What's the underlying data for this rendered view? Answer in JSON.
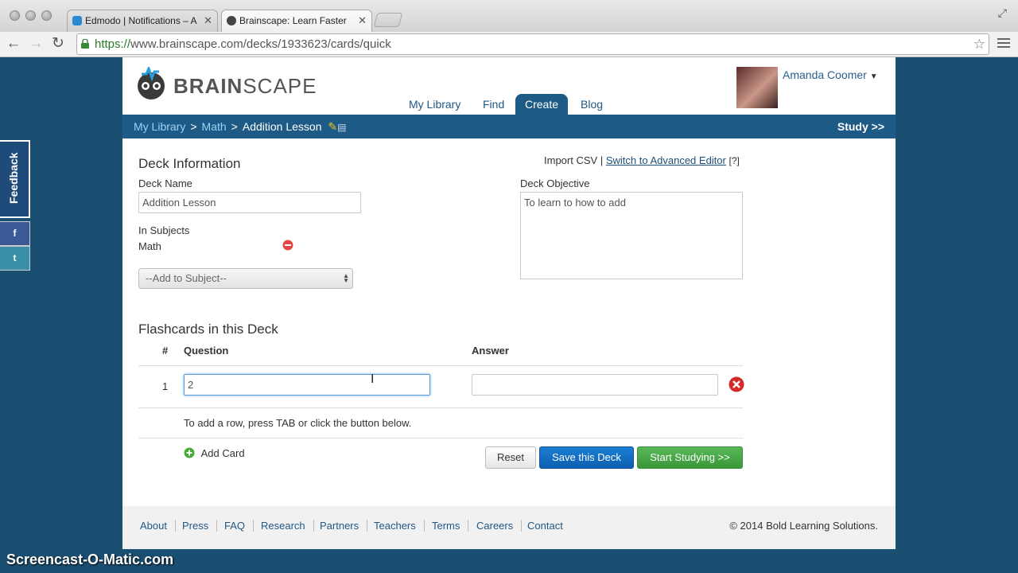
{
  "browser": {
    "tabs": [
      {
        "title": "Edmodo | Notifications – A",
        "active": false
      },
      {
        "title": "Brainscape: Learn Faster",
        "active": true
      }
    ],
    "url_scheme": "https://",
    "url_rest": "www.brainscape.com/decks/1933623/cards/quick"
  },
  "header": {
    "brand_bold": "BRAIN",
    "brand_light": "SCAPE",
    "username": "Amanda Coomer",
    "nav": [
      "My Library",
      "Find",
      "Create",
      "Blog"
    ],
    "nav_active": "Create"
  },
  "breadcrumb": {
    "items": [
      "My Library",
      "Math"
    ],
    "separator": ">",
    "current": "Addition Lesson",
    "study": "Study >>"
  },
  "deck_info": {
    "title": "Deck Information",
    "import_csv": "Import CSV",
    "pipe": "|",
    "advanced_editor": "Switch to Advanced Editor",
    "help": "[?]",
    "deck_name_label": "Deck Name",
    "deck_name_value": "Addition Lesson",
    "in_subjects_label": "In Subjects",
    "subject": "Math",
    "add_subject": "--Add to Subject--",
    "objective_label": "Deck Objective",
    "objective_value": "To learn to how to add"
  },
  "flashcards": {
    "title": "Flashcards in this Deck",
    "col_num": "#",
    "col_question": "Question",
    "col_answer": "Answer",
    "rows": [
      {
        "num": "1",
        "question": "2",
        "answer": ""
      }
    ],
    "hint": "To add a row, press TAB or click the button below.",
    "add_card": "Add Card",
    "reset": "Reset",
    "save": "Save this Deck",
    "start": "Start Studying >>"
  },
  "footer": {
    "links": [
      "About",
      "Press",
      "FAQ",
      "Research",
      "Partners",
      "Teachers",
      "Terms",
      "Careers",
      "Contact"
    ],
    "copyright": "© 2014 Bold Learning Solutions."
  },
  "side": {
    "feedback": "Feedback",
    "facebook": "f",
    "twitter": "t"
  },
  "watermark": "Screencast-O-Matic.com",
  "colors": {
    "brand_blue": "#1e5a86",
    "primary": "#0c5eb0",
    "success": "#3b973a",
    "background": "#1b4f72"
  }
}
